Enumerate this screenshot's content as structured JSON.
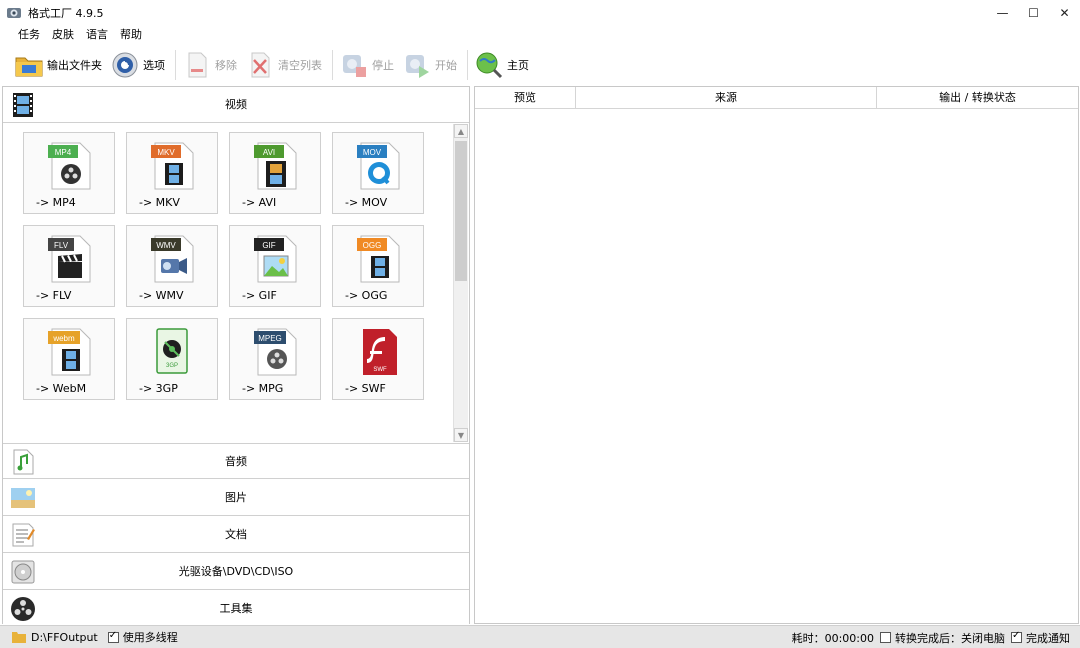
{
  "window": {
    "title": "格式工厂 4.9.5",
    "controls": {
      "minimize": "—",
      "maximize": "☐",
      "close": "✕"
    }
  },
  "menu": [
    {
      "label": "任务"
    },
    {
      "label": "皮肤"
    },
    {
      "label": "语言"
    },
    {
      "label": "帮助"
    }
  ],
  "toolbar": {
    "output_folder": "输出文件夹",
    "options": "选项",
    "remove": "移除",
    "clear_list": "清空列表",
    "stop": "停止",
    "start": "开始",
    "home": "主页"
  },
  "left": {
    "video_header": "视频",
    "formats": [
      {
        "label": "-> MP4",
        "badge": "MP4",
        "color": "#4caf50",
        "icon": "film-reel-icon"
      },
      {
        "label": "-> MKV",
        "badge": "MKV",
        "color": "#e06c2b",
        "icon": "film-strip-icon"
      },
      {
        "label": "-> AVI",
        "badge": "AVI",
        "color": "#4e9a2f",
        "icon": "film-strip-icon"
      },
      {
        "label": "-> MOV",
        "badge": "MOV",
        "color": "#2a7fc1",
        "icon": "quicktime-icon"
      },
      {
        "label": "-> FLV",
        "badge": "FLV",
        "color": "#444444",
        "icon": "clapper-icon"
      },
      {
        "label": "-> WMV",
        "badge": "WMV",
        "color": "#3a3a2a",
        "icon": "camcorder-icon"
      },
      {
        "label": "-> GIF",
        "badge": "GIF",
        "color": "#222222",
        "icon": "picture-icon"
      },
      {
        "label": "-> OGG",
        "badge": "OGG",
        "color": "#f08a24",
        "icon": "film-strip-icon"
      },
      {
        "label": "-> WebM",
        "badge": "webm",
        "color": "#e6a229",
        "icon": "film-strip-icon"
      },
      {
        "label": "-> 3GP",
        "badge": "3GP",
        "color": "#3a9a3a",
        "icon": "phone-film-icon"
      },
      {
        "label": "-> MPG",
        "badge": "MPEG",
        "color": "#2d4d6e",
        "icon": "film-reel-icon"
      },
      {
        "label": "-> SWF",
        "badge": "SWF",
        "color": "#c0202a",
        "icon": "flash-icon"
      }
    ],
    "categories": [
      {
        "label": "音频",
        "icon": "music-icon"
      },
      {
        "label": "图片",
        "icon": "picture-icon"
      },
      {
        "label": "文档",
        "icon": "document-icon"
      },
      {
        "label": "光驱设备\\DVD\\CD\\ISO",
        "icon": "disc-icon"
      },
      {
        "label": "工具集",
        "icon": "film-reel-icon"
      }
    ]
  },
  "right": {
    "columns": [
      "预览",
      "来源",
      "输出 / 转换状态"
    ]
  },
  "status": {
    "output_path": "D:\\FFOutput",
    "multithread_label": "使用多线程",
    "multithread_checked": true,
    "elapsed_label": "耗时：00:00:00",
    "after_convert_label": "转换完成后：关闭电脑",
    "after_convert_checked": false,
    "notify_label": "完成通知",
    "notify_checked": true
  }
}
